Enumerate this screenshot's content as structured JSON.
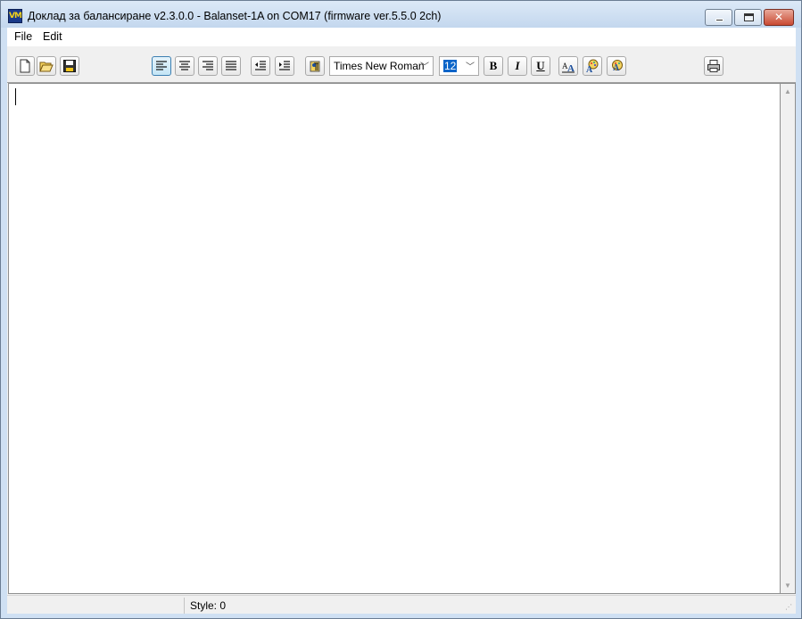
{
  "window": {
    "title": "Доклад за балансиране v2.3.0.0 - Balanset-1A on COM17 (firmware ver.5.5.0 2ch)",
    "app_icon_text": "VM",
    "controls": {
      "minimize": "minimize-icon",
      "maximize": "maximize-icon",
      "close": "close-icon"
    }
  },
  "menu": {
    "items": [
      {
        "label": "File"
      },
      {
        "label": "Edit"
      }
    ]
  },
  "toolbar": {
    "font_name": "Times New Roman",
    "font_size": "12",
    "bold_label": "B",
    "italic_label": "I",
    "underline_label": "U",
    "icons": [
      "new-document-icon",
      "open-folder-icon",
      "save-disk-icon",
      "align-left-icon",
      "align-center-icon",
      "align-right-icon",
      "align-justify-icon",
      "outdent-icon",
      "indent-icon",
      "paragraph-icon",
      "font-format-icon",
      "text-color-icon",
      "background-color-icon",
      "print-icon"
    ],
    "active_alignment": "left"
  },
  "editor": {
    "content": ""
  },
  "statusbar": {
    "style_text": "Style: 0"
  },
  "colors": {
    "accent": "#3c7fb1",
    "close_button": "#c94a33",
    "selection": "#0a64c8"
  }
}
